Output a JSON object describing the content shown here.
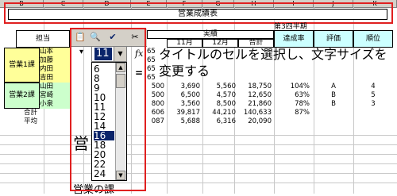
{
  "columns": [
    "B",
    "C",
    "D",
    "E",
    "F",
    "G",
    "H",
    "I",
    "J",
    "K"
  ],
  "title_bar": {
    "text": "営業成績表"
  },
  "subtitle": "第3四半期",
  "headers": {
    "tanto": "担当",
    "jisseki": "実績",
    "month11": "11月",
    "month12": "12月",
    "total": "合計",
    "rate": "達成率",
    "eval": "評価",
    "rank": "順位"
  },
  "groups": {
    "g1": "営業1課",
    "g2": "営業2課"
  },
  "names": [
    "山本",
    "加藤",
    "内田",
    "吉田",
    "山田",
    "宮崎",
    "小泉"
  ],
  "rows": [
    {
      "c10": "500",
      "m11": "3,690",
      "m12": "5,560",
      "total": "18,750",
      "rate": "104%",
      "eval": "A",
      "rank": "4"
    },
    {
      "c10": "500",
      "m11": "6,500",
      "m12": "4,570",
      "total": "12,650",
      "rate": "63%",
      "eval": "B",
      "rank": "5"
    },
    {
      "c10": "800",
      "m11": "3,560",
      "m12": "8,500",
      "total": "21,860",
      "rate": "78%",
      "eval": "B",
      "rank": "3"
    }
  ],
  "summary": {
    "total_label": "合計",
    "avg_label": "平均",
    "total_vals": [
      "606",
      "39,817",
      "44,210",
      "140,633",
      "87%"
    ],
    "avg_vals": [
      "087",
      "5,688",
      "6,316",
      "20,090"
    ]
  },
  "left_partial": [
    "65",
    "65",
    "65",
    "65",
    "65"
  ],
  "toolbar": {
    "icons": [
      "clipboard-icon",
      "search-icon",
      "check-icon",
      "scissors-icon"
    ]
  },
  "font_size": {
    "value": "11",
    "options": [
      "6",
      "8",
      "9",
      "10",
      "11",
      "12",
      "14",
      "16",
      "18",
      "20",
      "22",
      "24"
    ],
    "selected": "16"
  },
  "instruction": "タイトルのセルを選択し、文字サイズを変更する",
  "preview_text": "営",
  "bottom_text": "営業の課",
  "fx_label": "fx",
  "eq_label": "=",
  "accent_red": "#e02020",
  "highlight_blue": "#0a246a"
}
